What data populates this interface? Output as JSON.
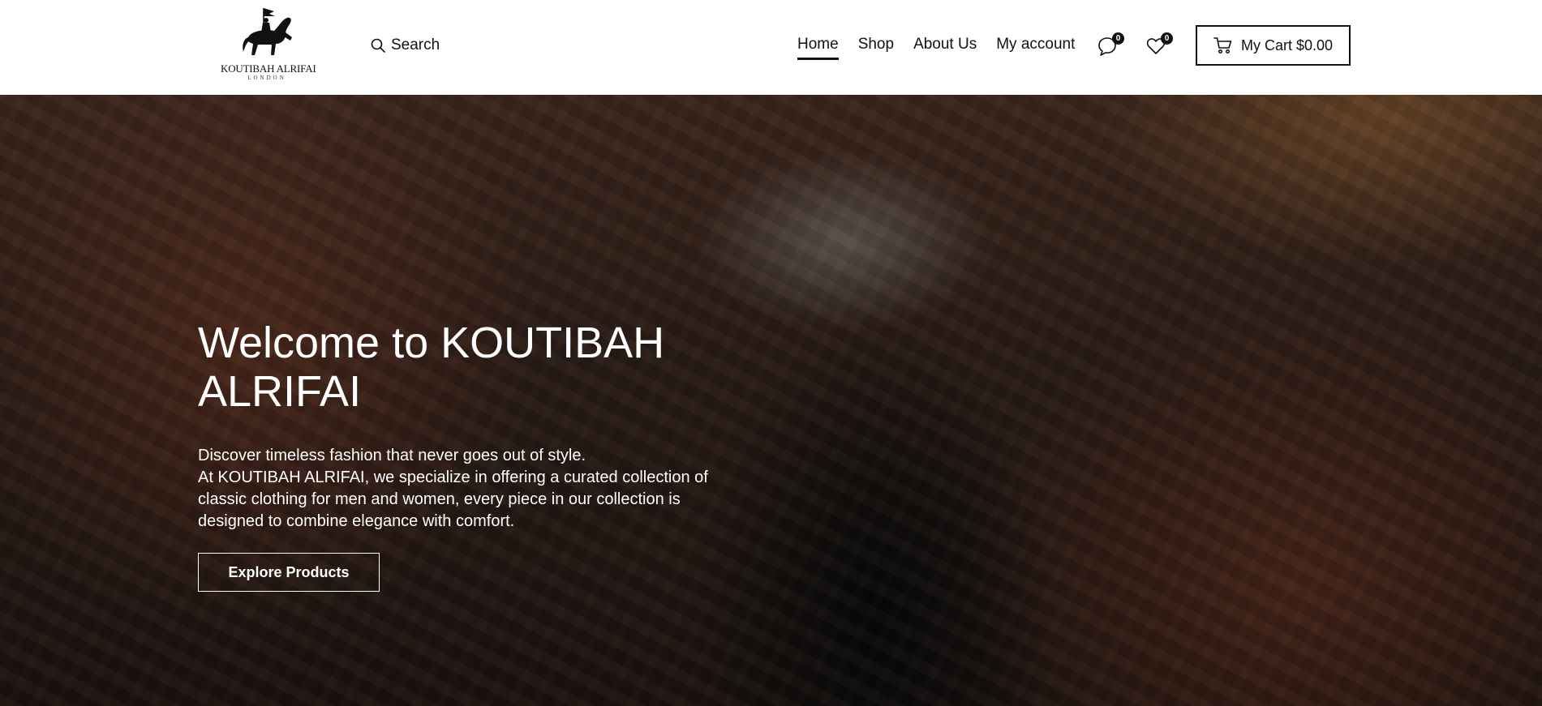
{
  "brand": {
    "name": "KOUTIBAH ALRIFAI",
    "location": "LONDON"
  },
  "search": {
    "label": "Search"
  },
  "nav": {
    "items": [
      {
        "label": "Home",
        "active": true
      },
      {
        "label": "Shop",
        "active": false
      },
      {
        "label": "About Us",
        "active": false
      },
      {
        "label": "My account",
        "active": false
      }
    ]
  },
  "header_icons": {
    "compare": {
      "icon": "compare-icon",
      "count": "0"
    },
    "wishlist": {
      "icon": "heart-icon",
      "count": "0"
    }
  },
  "cart": {
    "label": "My Cart $0.00",
    "icon": "cart-icon"
  },
  "hero": {
    "title": "Welcome to KOUTIBAH ALRIFAI",
    "line1": "Discover timeless fashion that never goes out of style.",
    "line2": "At KOUTIBAH ALRIFAI, we specialize in offering a curated collection of classic clothing for men and women, every piece in our collection is designed to combine elegance with comfort.",
    "button_label": "Explore Products"
  },
  "colors": {
    "text": "#111111",
    "hero_text": "#ffffff",
    "header_bg": "#ffffff"
  }
}
